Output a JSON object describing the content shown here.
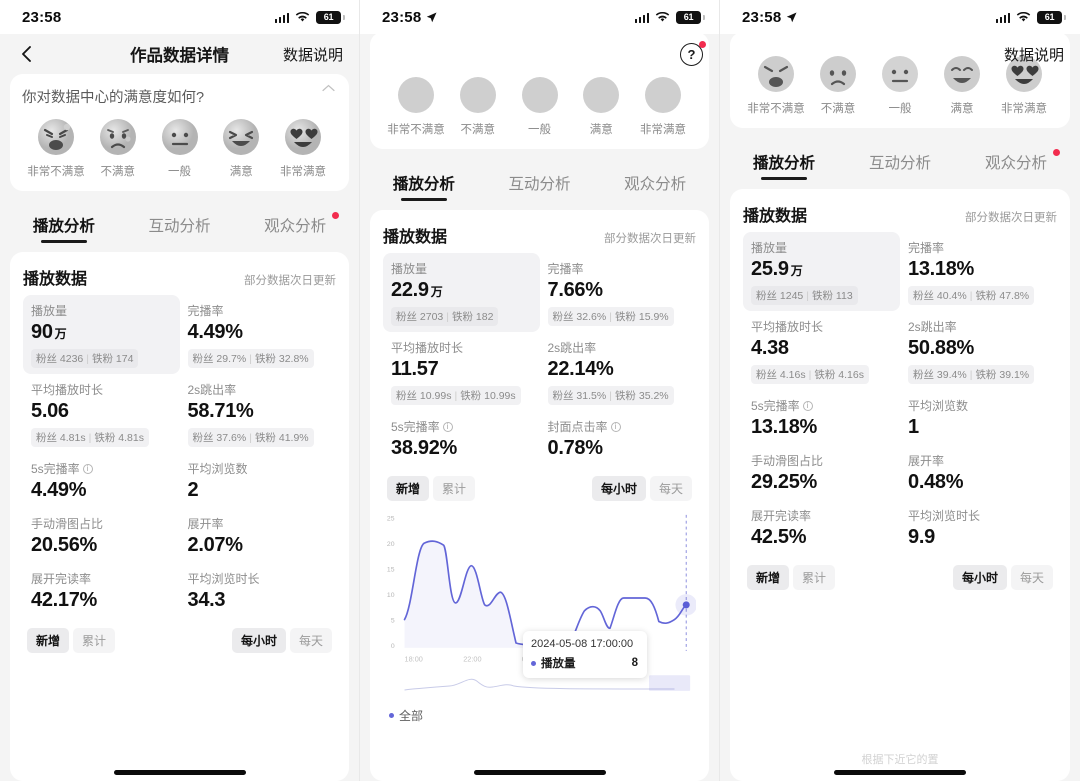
{
  "statusbar": {
    "time": "23:58",
    "battery_level": "61",
    "signal_icon": "cellular-bars-icon",
    "wifi_icon": "wifi-icon",
    "location_icon": "location-arrow-icon"
  },
  "nav": {
    "title": "作品数据详情",
    "right_label": "数据说明",
    "help_label": "?",
    "back_icon": "chevron-left-icon"
  },
  "survey": {
    "question": "你对数据中心的满意度如何?",
    "collapse_icon": "chevron-up-icon",
    "options": [
      {
        "label": "非常不满意",
        "icon": "angry-face-icon"
      },
      {
        "label": "不满意",
        "icon": "sad-face-icon"
      },
      {
        "label": "一般",
        "icon": "neutral-face-icon"
      },
      {
        "label": "满意",
        "icon": "happy-face-icon"
      },
      {
        "label": "非常满意",
        "icon": "heart-eyes-face-icon"
      }
    ]
  },
  "tabs": [
    {
      "label": "播放分析",
      "active": true,
      "badge": false
    },
    {
      "label": "互动分析",
      "active": false,
      "badge": false
    },
    {
      "label": "观众分析",
      "active": false,
      "badge": true
    }
  ],
  "card": {
    "title": "播放数据",
    "note": "部分数据次日更新"
  },
  "chips": {
    "left": [
      {
        "label": "新增",
        "on": true
      },
      {
        "label": "累计",
        "on": false
      }
    ],
    "right": [
      {
        "label": "每小时",
        "on": true
      },
      {
        "label": "每天",
        "on": false
      }
    ]
  },
  "fans_prefix": "粉丝",
  "iron_prefix": "铁粉",
  "panel1": {
    "metrics": [
      {
        "label": "播放量",
        "value": "90",
        "unit": "万",
        "sub_a": "粉丝 4236",
        "sub_b": "铁粉 174",
        "highlight": true,
        "info": false
      },
      {
        "label": "完播率",
        "value": "4.49%",
        "unit": "",
        "sub_a": "粉丝 29.7%",
        "sub_b": "铁粉 32.8%",
        "highlight": false,
        "info": false
      },
      {
        "label": "平均播放时长",
        "value": "5.06",
        "unit": "",
        "sub_a": "粉丝 4.81s",
        "sub_b": "铁粉 4.81s",
        "highlight": false,
        "info": false
      },
      {
        "label": "2s跳出率",
        "value": "58.71%",
        "unit": "",
        "sub_a": "粉丝 37.6%",
        "sub_b": "铁粉 41.9%",
        "highlight": false,
        "info": false
      },
      {
        "label": "5s完播率",
        "value": "4.49%",
        "unit": "",
        "sub_a": "",
        "sub_b": "",
        "highlight": false,
        "info": true
      },
      {
        "label": "平均浏览数",
        "value": "2",
        "unit": "",
        "sub_a": "",
        "sub_b": "",
        "highlight": false,
        "info": false
      },
      {
        "label": "手动滑图占比",
        "value": "20.56%",
        "unit": "",
        "sub_a": "",
        "sub_b": "",
        "highlight": false,
        "info": false
      },
      {
        "label": "展开率",
        "value": "2.07%",
        "unit": "",
        "sub_a": "",
        "sub_b": "",
        "highlight": false,
        "info": false
      },
      {
        "label": "展开完读率",
        "value": "42.17%",
        "unit": "",
        "sub_a": "",
        "sub_b": "",
        "highlight": false,
        "info": false
      },
      {
        "label": "平均浏览时长",
        "value": "34.3",
        "unit": "",
        "sub_a": "",
        "sub_b": "",
        "highlight": false,
        "info": false
      }
    ]
  },
  "panel2": {
    "metrics": [
      {
        "label": "播放量",
        "value": "22.9",
        "unit": "万",
        "sub_a": "粉丝 2703",
        "sub_b": "铁粉 182",
        "highlight": true,
        "info": false
      },
      {
        "label": "完播率",
        "value": "7.66%",
        "unit": "",
        "sub_a": "粉丝 32.6%",
        "sub_b": "铁粉 15.9%",
        "highlight": false,
        "info": false
      },
      {
        "label": "平均播放时长",
        "value": "11.57",
        "unit": "",
        "sub_a": "粉丝 10.99s",
        "sub_b": "铁粉 10.99s",
        "highlight": false,
        "info": false
      },
      {
        "label": "2s跳出率",
        "value": "22.14%",
        "unit": "",
        "sub_a": "粉丝 31.5%",
        "sub_b": "铁粉 35.2%",
        "highlight": false,
        "info": false
      },
      {
        "label": "5s完播率",
        "value": "38.92%",
        "unit": "",
        "sub_a": "",
        "sub_b": "",
        "highlight": false,
        "info": true
      },
      {
        "label": "封面点击率",
        "value": "0.78%",
        "unit": "",
        "sub_a": "",
        "sub_b": "",
        "highlight": false,
        "info": true
      }
    ],
    "tooltip": {
      "time": "2024-05-08 17:00:00",
      "series": "播放量",
      "value": "8"
    },
    "legend": "全部"
  },
  "panel3": {
    "metrics": [
      {
        "label": "播放量",
        "value": "25.9",
        "unit": "万",
        "sub_a": "粉丝 1245",
        "sub_b": "铁粉 113",
        "highlight": true,
        "info": false
      },
      {
        "label": "完播率",
        "value": "13.18%",
        "unit": "",
        "sub_a": "粉丝 40.4%",
        "sub_b": "铁粉 47.8%",
        "highlight": false,
        "info": false
      },
      {
        "label": "平均播放时长",
        "value": "4.38",
        "unit": "",
        "sub_a": "粉丝 4.16s",
        "sub_b": "铁粉 4.16s",
        "highlight": false,
        "info": false
      },
      {
        "label": "2s跳出率",
        "value": "50.88%",
        "unit": "",
        "sub_a": "粉丝 39.4%",
        "sub_b": "铁粉 39.1%",
        "highlight": false,
        "info": false
      },
      {
        "label": "5s完播率",
        "value": "13.18%",
        "unit": "",
        "sub_a": "",
        "sub_b": "",
        "highlight": false,
        "info": true
      },
      {
        "label": "平均浏览数",
        "value": "1",
        "unit": "",
        "sub_a": "",
        "sub_b": "",
        "highlight": false,
        "info": false
      },
      {
        "label": "手动滑图占比",
        "value": "29.25%",
        "unit": "",
        "sub_a": "",
        "sub_b": "",
        "highlight": false,
        "info": false
      },
      {
        "label": "展开率",
        "value": "0.48%",
        "unit": "",
        "sub_a": "",
        "sub_b": "",
        "highlight": false,
        "info": false
      },
      {
        "label": "展开完读率",
        "value": "42.5%",
        "unit": "",
        "sub_a": "",
        "sub_b": "",
        "highlight": false,
        "info": false
      },
      {
        "label": "平均浏览时长",
        "value": "9.9",
        "unit": "",
        "sub_a": "",
        "sub_b": "",
        "highlight": false,
        "info": false
      }
    ],
    "faint_text": "根据下近它的置"
  },
  "colors": {
    "accent": "#6366d8",
    "badge": "#f22c4e",
    "card_bg": "#ffffff",
    "page_bg": "#f4f4f4",
    "text_primary": "#111111",
    "text_muted": "#8d8d8d"
  },
  "chart_data": {
    "type": "line",
    "title": "播放量",
    "xlabel": "",
    "ylabel": "",
    "ylim": [
      0,
      25
    ],
    "yticks": [
      0,
      5,
      10,
      15,
      20,
      25
    ],
    "xticks": [
      "18:00",
      "22:00",
      "02:00"
    ],
    "grid": false,
    "legend": "全部",
    "legend_position": "bottom-left",
    "series": [
      {
        "name": "播放量",
        "color": "#6366d8",
        "x": [
          "17:00",
          "18:00",
          "19:00",
          "20:00",
          "21:00",
          "22:00",
          "23:00",
          "00:00",
          "01:00",
          "02:00",
          "03:00",
          "04:00",
          "05:00",
          "06:00",
          "07:00",
          "08:00",
          "09:00",
          "10:00",
          "11:00",
          "12:00",
          "13:00",
          "14:00",
          "15:00",
          "16:00",
          "17:00"
        ],
        "values": [
          5,
          12,
          22,
          22,
          8,
          17,
          7,
          9,
          9,
          6,
          1,
          1,
          1,
          1,
          1,
          5,
          8,
          6,
          4,
          10,
          10,
          10,
          5,
          6,
          8
        ]
      }
    ],
    "annotation": {
      "time": "2024-05-08 17:00:00",
      "series": "播放量",
      "value": 8
    }
  }
}
